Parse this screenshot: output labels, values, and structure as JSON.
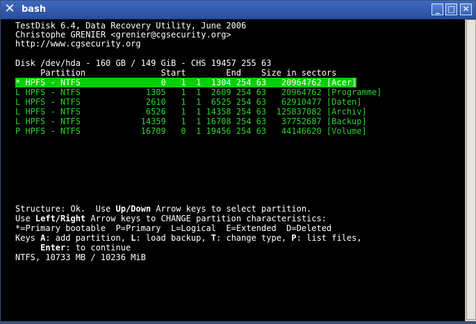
{
  "window": {
    "title": "bash",
    "icons": {
      "app": "x-terminal-icon",
      "minimize": "minimize-icon",
      "maximize": "maximize-icon",
      "close": "close-icon"
    }
  },
  "terminal": {
    "header": [
      "TestDisk 6.4, Data Recovery Utility, June 2006",
      "Christophe GRENIER <grenier@cgsecurity.org>",
      "http://www.cgsecurity.org"
    ],
    "disk_line": "Disk /dev/hda - 160 GB / 149 GiB - CHS 19457 255 63",
    "columns_line": "     Partition               Start        End    Size in sectors",
    "partitions": [
      "* HPFS - NTFS                0   1  1  1304 254 63   20964762 [Acer]",
      "L HPFS - NTFS             1305   1  1  2609 254 63   20964762 [Programme]",
      "L HPFS - NTFS             2610   1  1  6525 254 63   62910477 [Daten]",
      "L HPFS - NTFS             6526   1  1 14358 254 63  125837082 [Archiv]",
      "L HPFS - NTFS            14359   1  1 16708 254 63   37752687 [Backup]",
      "P HPFS - NTFS            16709   0  1 19456 254 63   44146620 [Volume]"
    ],
    "help": {
      "l1_a": "Structure: Ok.  Use ",
      "l1_b": "Up/Down",
      "l1_c": " Arrow keys to select partition.",
      "l2_a": "Use ",
      "l2_b": "Left/Right",
      "l2_c": " Arrow keys to CHANGE partition characteristics:",
      "l3": "*=Primary bootable  P=Primary  L=Logical  E=Extended  D=Deleted",
      "l4_a": "Keys ",
      "l4_b": "A",
      "l4_c": ": add partition, ",
      "l4_d": "L",
      "l4_e": ": load backup, ",
      "l4_f": "T",
      "l4_g": ": change type, ",
      "l4_h": "P",
      "l4_i": ": list files,",
      "l5_a": "     ",
      "l5_b": "Enter",
      "l5_c": ": to continue",
      "l6": "NTFS, 10733 MB / 10236 MiB"
    }
  }
}
